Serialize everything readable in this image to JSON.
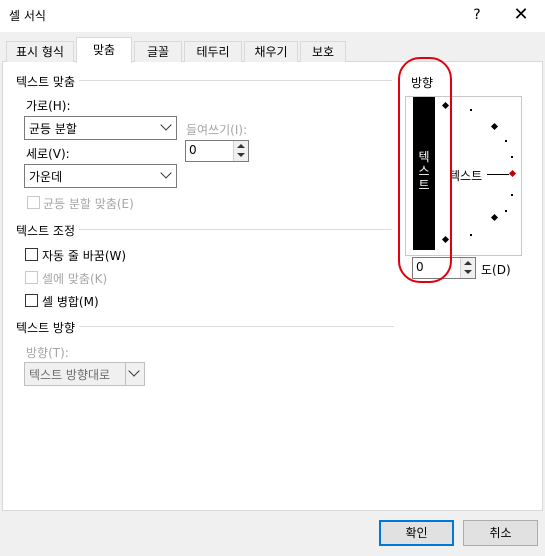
{
  "window": {
    "title": "셀 서식",
    "help": "?",
    "close": "✕"
  },
  "tabs": [
    {
      "label": "표시 형식"
    },
    {
      "label": "맞춤"
    },
    {
      "label": "글꼴"
    },
    {
      "label": "테두리"
    },
    {
      "label": "채우기"
    },
    {
      "label": "보호"
    }
  ],
  "text_alignment": {
    "section": "텍스트 맞춤",
    "horizontal_label": "가로(H):",
    "horizontal_value": "균등 분할",
    "indent_label": "들여쓰기(I):",
    "indent_value": "0",
    "vertical_label": "세로(V):",
    "vertical_value": "가운데",
    "justify_distributed": "균등 분할 맞춤(E)"
  },
  "text_control": {
    "section": "텍스트 조정",
    "wrap_text": "자동 줄 바꿈(W)",
    "shrink_to_fit": "셀에 맞춤(K)",
    "merge_cells": "셀 병합(M)"
  },
  "right_to_left": {
    "section": "텍스트 방향",
    "direction_label": "방향(T):",
    "direction_value": "텍스트 방향대로"
  },
  "orientation": {
    "section": "방향",
    "vertical_text": "텍\n스\n트",
    "horizontal_text": "텍스트",
    "degrees_value": "0",
    "degrees_label": "도(D)"
  },
  "buttons": {
    "ok": "확인",
    "cancel": "취소"
  }
}
